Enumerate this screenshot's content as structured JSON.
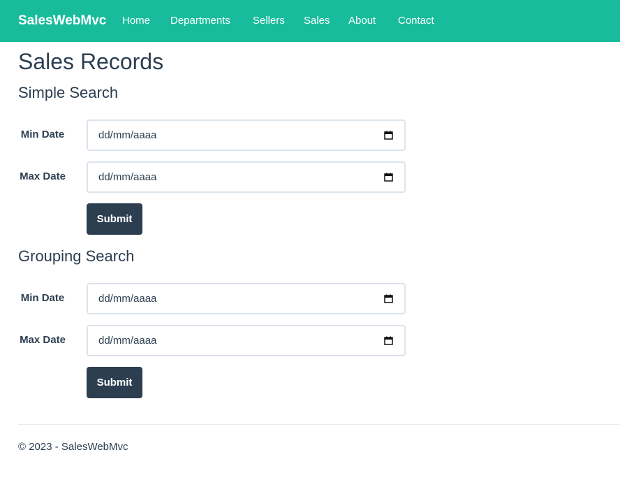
{
  "navbar": {
    "brand": "SalesWebMvc",
    "links": [
      "Home",
      "Departments",
      "Sellers",
      "Sales",
      "About",
      "Contact"
    ]
  },
  "page": {
    "title": "Sales Records"
  },
  "simple_search": {
    "title": "Simple Search",
    "min_label": "Min Date",
    "max_label": "Max Date",
    "min_value": "dd/mm/aaaa",
    "max_value": "dd/mm/aaaa",
    "submit_label": "Submit"
  },
  "grouping_search": {
    "title": "Grouping Search",
    "min_label": "Min Date",
    "max_label": "Max Date",
    "min_value": "dd/mm/aaaa",
    "max_value": "dd/mm/aaaa",
    "submit_label": "Submit"
  },
  "footer": {
    "text": "© 2023 - SalesWebMvc"
  },
  "icons": {
    "date_picker": "calendar-icon"
  },
  "colors": {
    "navbar": "#18bc9c",
    "primary": "#2c3e50",
    "input_border": "#dce4ec"
  }
}
